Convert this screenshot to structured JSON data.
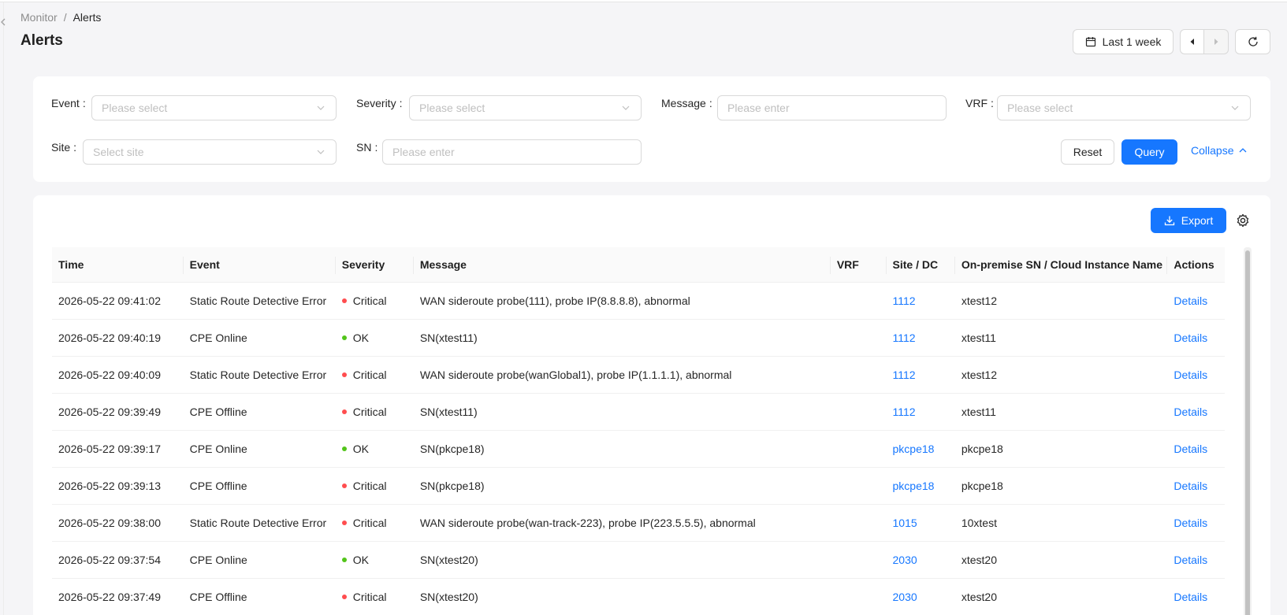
{
  "breadcrumb": {
    "parent": "Monitor",
    "separator": "/",
    "current": "Alerts"
  },
  "page": {
    "title": "Alerts"
  },
  "toolbar": {
    "range_label": "Last 1 week"
  },
  "filters": {
    "event": {
      "label": "Event",
      "placeholder": "Please select"
    },
    "severity": {
      "label": "Severity",
      "placeholder": "Please select"
    },
    "message": {
      "label": "Message",
      "placeholder": "Please enter"
    },
    "vrf": {
      "label": "VRF",
      "placeholder": "Please select"
    },
    "site": {
      "label": "Site",
      "placeholder": "Select site"
    },
    "sn": {
      "label": "SN",
      "placeholder": "Please enter"
    },
    "colon": ":",
    "reset_label": "Reset",
    "query_label": "Query",
    "collapse_label": "Collapse"
  },
  "table_toolbar": {
    "export_label": "Export"
  },
  "colors": {
    "primary": "#1677ff",
    "critical": "#ff4d4f",
    "ok": "#52c41a"
  },
  "table": {
    "columns": [
      "Time",
      "Event",
      "Severity",
      "Message",
      "VRF",
      "Site / DC",
      "On-premise SN / Cloud Instance Name",
      "Actions"
    ],
    "rows": [
      {
        "time": "2026-05-22 09:41:02",
        "event": "Static Route Detective Error",
        "severity": "Critical",
        "message": "WAN sideroute probe(111), probe IP(8.8.8.8), abnormal",
        "vrf": "",
        "site": "1112",
        "sn": "xtest12",
        "action": "Details"
      },
      {
        "time": "2026-05-22 09:40:19",
        "event": "CPE Online",
        "severity": "OK",
        "message": "SN(xtest11)",
        "vrf": "",
        "site": "1112",
        "sn": "xtest11",
        "action": "Details"
      },
      {
        "time": "2026-05-22 09:40:09",
        "event": "Static Route Detective Error",
        "severity": "Critical",
        "message": "WAN sideroute probe(wanGlobal1), probe IP(1.1.1.1), abnormal",
        "vrf": "",
        "site": "1112",
        "sn": "xtest12",
        "action": "Details"
      },
      {
        "time": "2026-05-22 09:39:49",
        "event": "CPE Offline",
        "severity": "Critical",
        "message": "SN(xtest11)",
        "vrf": "",
        "site": "1112",
        "sn": "xtest11",
        "action": "Details"
      },
      {
        "time": "2026-05-22 09:39:17",
        "event": "CPE Online",
        "severity": "OK",
        "message": "SN(pkcpe18)",
        "vrf": "",
        "site": "pkcpe18",
        "sn": "pkcpe18",
        "action": "Details"
      },
      {
        "time": "2026-05-22 09:39:13",
        "event": "CPE Offline",
        "severity": "Critical",
        "message": "SN(pkcpe18)",
        "vrf": "",
        "site": "pkcpe18",
        "sn": "pkcpe18",
        "action": "Details"
      },
      {
        "time": "2026-05-22 09:38:00",
        "event": "Static Route Detective Error",
        "severity": "Critical",
        "message": "WAN sideroute probe(wan-track-223), probe IP(223.5.5.5), abnormal",
        "vrf": "",
        "site": "1015",
        "sn": "10xtest",
        "action": "Details"
      },
      {
        "time": "2026-05-22 09:37:54",
        "event": "CPE Online",
        "severity": "OK",
        "message": "SN(xtest20)",
        "vrf": "",
        "site": "2030",
        "sn": "xtest20",
        "action": "Details"
      },
      {
        "time": "2026-05-22 09:37:49",
        "event": "CPE Offline",
        "severity": "Critical",
        "message": "SN(xtest20)",
        "vrf": "",
        "site": "2030",
        "sn": "xtest20",
        "action": "Details"
      }
    ]
  }
}
